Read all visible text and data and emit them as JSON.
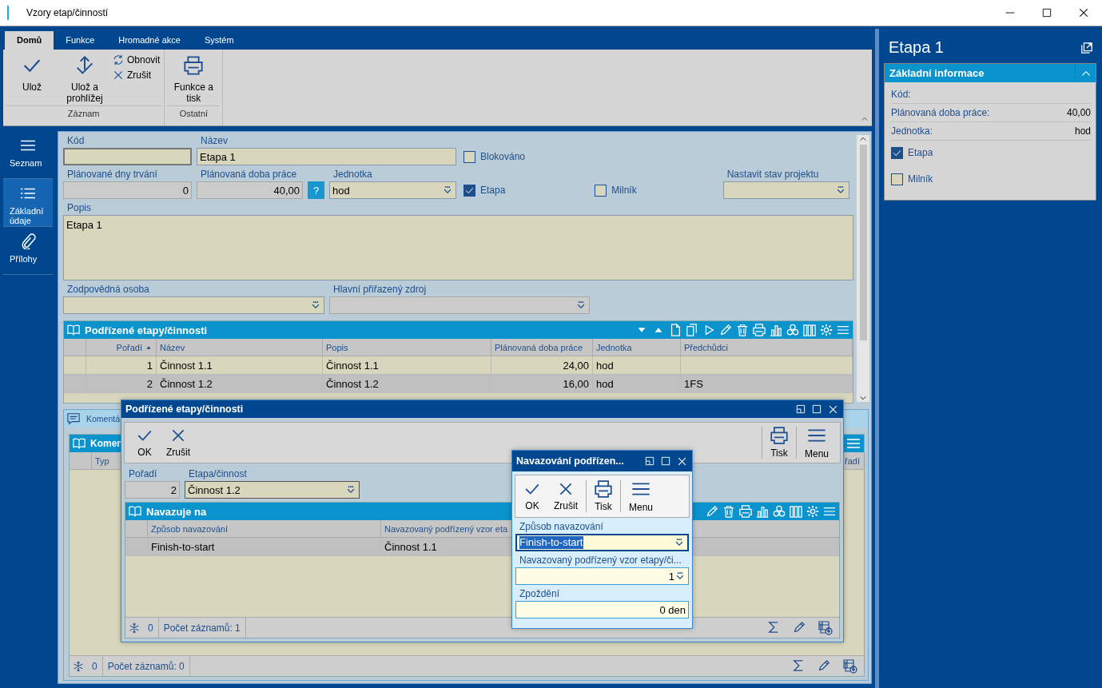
{
  "window": {
    "title": "Vzory etap/činností"
  },
  "ribbon": {
    "tabs": [
      {
        "label": "Domů",
        "selected": true
      },
      {
        "label": "Funkce",
        "selected": false
      },
      {
        "label": "Hromadné akce",
        "selected": false
      },
      {
        "label": "Systém",
        "selected": false
      }
    ],
    "groups": [
      {
        "label": "Záznam",
        "buttons": [
          {
            "label": "Ulož",
            "kind": "large"
          },
          {
            "label": "Ulož a prohlížej",
            "kind": "large"
          },
          {
            "label": "Obnovit",
            "kind": "small"
          },
          {
            "label": "Zrušit",
            "kind": "small"
          }
        ]
      },
      {
        "label": "Ostatní",
        "buttons": [
          {
            "label": "Funkce a tisk",
            "kind": "large"
          }
        ]
      }
    ]
  },
  "nav": [
    {
      "label": "Seznam",
      "selected": false
    },
    {
      "label": "Základní údaje",
      "selected": true
    },
    {
      "label": "Přílohy",
      "selected": false
    }
  ],
  "form": {
    "kod": {
      "label": "Kód",
      "disabled": false
    },
    "nazev": {
      "label": "Název",
      "value": "Etapa 1",
      "disabled": false
    },
    "blokovano": {
      "label": "Blokováno",
      "checked": false
    },
    "dny": {
      "label": "Plánované dny trvání",
      "value": "0",
      "disabled": true
    },
    "doba": {
      "label": "Plánovaná doba práce",
      "value": "40,00",
      "disabled": true,
      "help": "?"
    },
    "jednotka": {
      "label": "Jednotka",
      "value": "hod",
      "disabled": false
    },
    "etapa": {
      "label": "Etapa",
      "checked": true
    },
    "milnik": {
      "label": "Milník",
      "checked": false
    },
    "stav": {
      "label": "Nastavit stav projektu",
      "disabled": false
    },
    "popis": {
      "label": "Popis",
      "value": "Etapa 1"
    },
    "osoba": {
      "label": "Zodpovědná osoba",
      "disabled": false
    },
    "zdroj": {
      "label": "Hlavní přiřazený zdroj",
      "disabled": true
    }
  },
  "grid": {
    "title": "Podřízené etapy/činnosti",
    "columns": [
      {
        "label": "Pořadí",
        "sorted": true
      },
      {
        "label": "Název",
        "sorted": false
      },
      {
        "label": "Popis",
        "sorted": false
      },
      {
        "label": "Plánovaná doba práce",
        "sorted": false
      },
      {
        "label": "Jednotka",
        "sorted": false
      },
      {
        "label": "Předchůdci",
        "sorted": false
      }
    ],
    "rows": [
      {
        "cells": [
          "1",
          "Činnost 1.1",
          "Činnost 1.1",
          "24,00",
          "hod"
        ],
        "selected": false
      },
      {
        "cells": [
          "2",
          "Činnost 1.2",
          "Činnost 1.2",
          "16,00",
          "hod",
          "1FS"
        ],
        "selected": true
      }
    ]
  },
  "comments": {
    "tab_label": "Komentá",
    "grid_title": "Komen",
    "columns": [
      "Typ",
      "řadí"
    ],
    "status_count": "0",
    "status_records": "Počet záznamů: 0"
  },
  "dialog": {
    "title": "Podřízené etapy/činnosti",
    "buttons": [
      {
        "label": "OK"
      },
      {
        "label": "Zrušit"
      },
      {
        "label": "Tisk"
      },
      {
        "label": "Menu"
      }
    ],
    "poradi": {
      "label": "Pořadí",
      "value": "2"
    },
    "etapa": {
      "label": "Etapa/činnost",
      "value": "Činnost 1.2"
    },
    "grid": {
      "title": "Navazuje na",
      "columns": [
        "Způsob navazování",
        "Navazovaný podřízený vzor eta"
      ],
      "rows": [
        {
          "cells": [
            "Finish-to-start",
            "Činnost 1.1"
          ],
          "selected": true
        }
      ]
    },
    "status_count": "0",
    "status_records": "Počet záznamů: 1"
  },
  "popup": {
    "title": "Navazování podřízen...",
    "buttons": [
      {
        "label": "OK"
      },
      {
        "label": "Zrušit"
      },
      {
        "label": "Tisk"
      },
      {
        "label": "Menu"
      }
    ],
    "fields": [
      {
        "label": "Způsob navazování",
        "value": "Finish-to-start",
        "focused": true
      },
      {
        "label": "Navazovaný podřízený vzor etapy/či...",
        "value": "1",
        "focused": false
      },
      {
        "label": "Zpoždění",
        "value": "0 den",
        "focused": false
      }
    ]
  },
  "side": {
    "title": "Etapa 1",
    "section": {
      "title": "Základní informace",
      "expanded": true,
      "rows": [
        {
          "label": "Kód:"
        },
        {
          "label": "Plánovaná doba práce:",
          "value": "40,00"
        },
        {
          "label": "Jednotka:",
          "value": "hod"
        }
      ],
      "checks": [
        {
          "label": "Etapa",
          "checked": true
        },
        {
          "label": "Milník",
          "checked": false
        }
      ]
    }
  }
}
